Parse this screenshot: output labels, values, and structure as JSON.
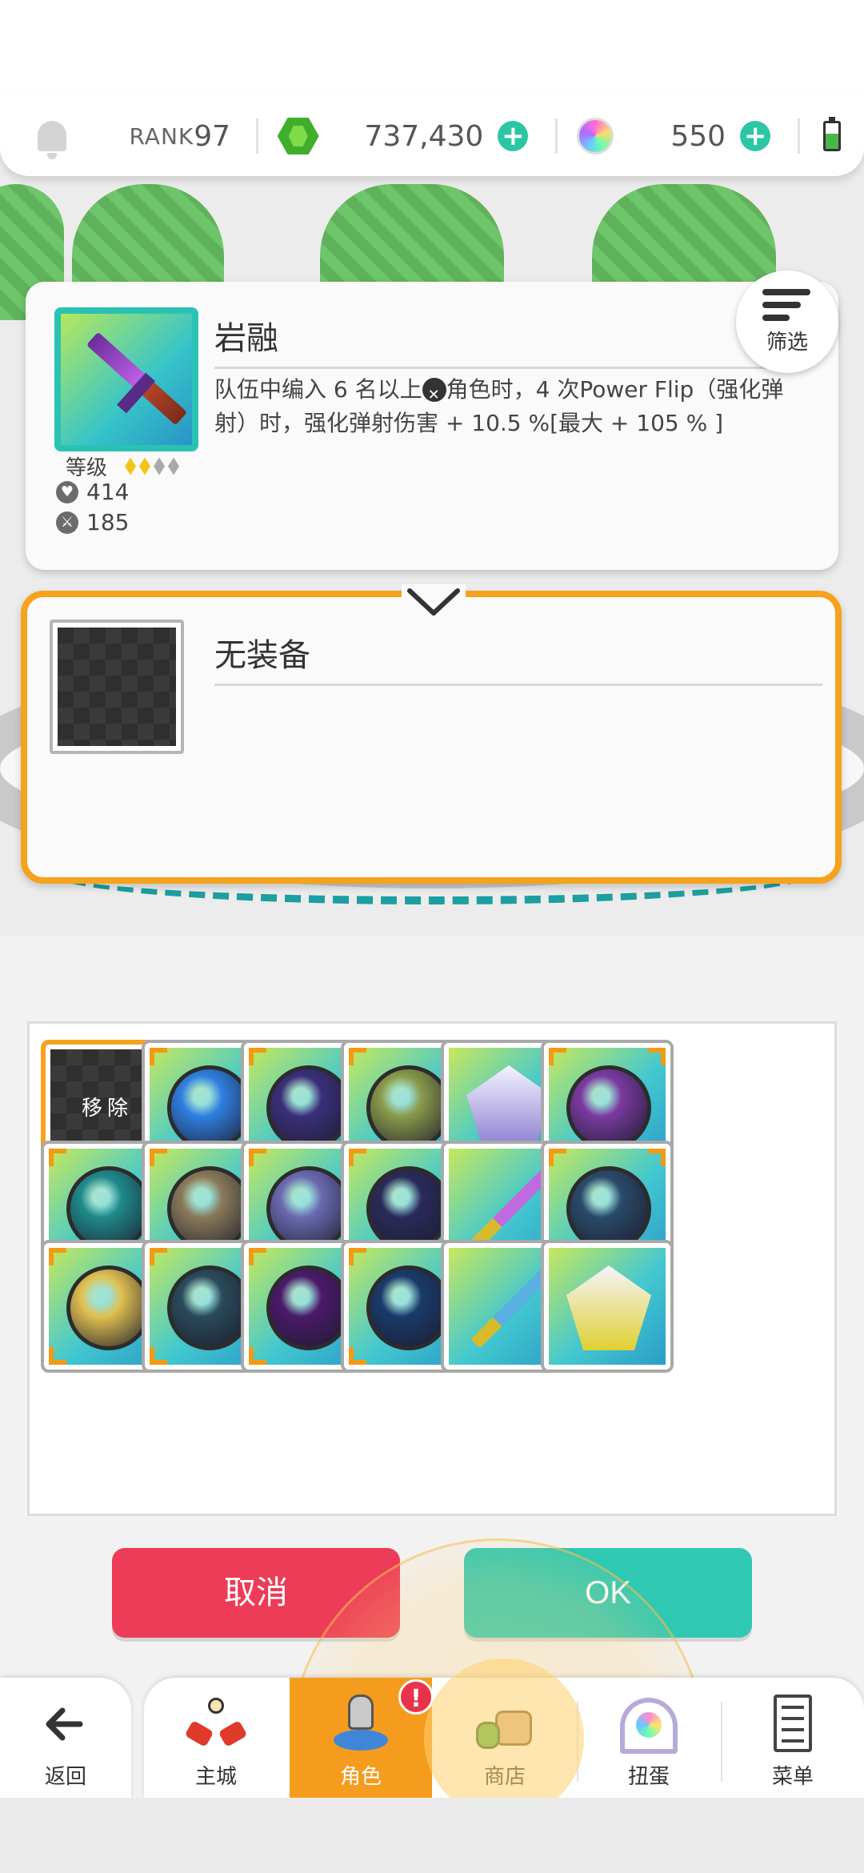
{
  "topbar": {
    "rank_label": "RANK",
    "rank_value": "97",
    "gems": "737,430",
    "orbs": "550",
    "plus_symbol": "+"
  },
  "equipped": {
    "name": "岩融",
    "description_part1": "队伍中编入 6 名以上",
    "description_part2": "角色时，4 次Power Flip（强化弹射）时，强化弹射伤害 + 10.5 %[最大 + 105 % ]",
    "grade_label": "等级",
    "grade_filled": 2,
    "grade_total": 4,
    "hp": "414",
    "atk": "185"
  },
  "filter": {
    "label": "筛选"
  },
  "slot": {
    "name": "无装备"
  },
  "grid": {
    "remove_label": "移除",
    "items": [
      {
        "kind": "remove"
      },
      {
        "kind": "orb",
        "icon": "ship-orb-icon",
        "color": "#2f7fe0"
      },
      {
        "kind": "orb",
        "icon": "dark-orb-icon",
        "color": "#3a2f7a"
      },
      {
        "kind": "orb",
        "icon": "frog-orb-icon",
        "color": "#8a9a4a"
      },
      {
        "kind": "crest",
        "icon": "silver-crest-icon",
        "color": "#8a7bd0"
      },
      {
        "kind": "orb",
        "icon": "partial-orb-icon",
        "color": "#7a3aa0"
      },
      {
        "kind": "orb",
        "icon": "turtle-orb-icon",
        "color": "#1f8a8a"
      },
      {
        "kind": "orb",
        "icon": "mountain-orb-icon",
        "color": "#8a7a5a"
      },
      {
        "kind": "orb",
        "icon": "crystal-orb-icon",
        "color": "#6a6ab0"
      },
      {
        "kind": "orb",
        "icon": "star-orb-icon",
        "color": "#2a2a5a"
      },
      {
        "kind": "blade",
        "icon": "rainbow-sword-icon",
        "color": "#c06ae0"
      },
      {
        "kind": "orb",
        "icon": "partial-orb-icon",
        "color": "#2a4a6a"
      },
      {
        "kind": "orb",
        "icon": "sand-orb-icon",
        "color": "#e0c050"
      },
      {
        "kind": "orb",
        "icon": "ice-orb-icon",
        "color": "#2a4a5a"
      },
      {
        "kind": "orb",
        "icon": "shadow-orb-icon",
        "color": "#4a1a6a"
      },
      {
        "kind": "orb",
        "icon": "night-orb-icon",
        "color": "#1a3a6a"
      },
      {
        "kind": "blade",
        "icon": "blue-sword-icon",
        "color": "#5ab0e0"
      },
      {
        "kind": "crest",
        "icon": "partial-crest-icon",
        "color": "#e0d030"
      }
    ]
  },
  "buttons": {
    "cancel": "取消",
    "ok": "OK"
  },
  "nav": {
    "back": "返回",
    "items": [
      "主城",
      "角色",
      "商店",
      "扭蛋",
      "菜单"
    ],
    "badge": "!"
  },
  "colors": {
    "accent_orange": "#f6a21c",
    "cancel_red": "#ec3c57",
    "ok_teal": "#2fc9b3",
    "plus_teal": "#2cc6a4"
  }
}
